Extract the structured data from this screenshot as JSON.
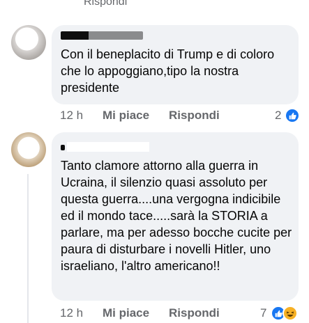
{
  "top_reply_link": "Rispondi",
  "comments": [
    {
      "text": "Con il beneplacito di Trump e di coloro che lo appoggiano,tipo la nostra presidente",
      "time": "12 h",
      "like_label": "Mi piace",
      "reply_label": "Rispondi",
      "reaction_count": "2",
      "reactions": [
        "like-icon"
      ]
    },
    {
      "text": "Tanto clamore attorno alla guerra in Ucraina, il silenzio quasi assoluto per questa guerra....una vergogna indicibile ed il mondo tace.....sarà la STORIA a parlare, ma per adesso bocche cucite per paura di disturbare i novelli Hitler, uno israeliano, l'altro americano!!",
      "time": "12 h",
      "like_label": "Mi piace",
      "reply_label": "Rispondi",
      "reaction_count": "7",
      "reactions": [
        "like-icon",
        "haha-icon"
      ]
    }
  ],
  "colors": {
    "bubble_bg": "#f0f2f5",
    "meta_text": "#65676b",
    "like_blue": "#1877f2",
    "text": "#050505"
  }
}
